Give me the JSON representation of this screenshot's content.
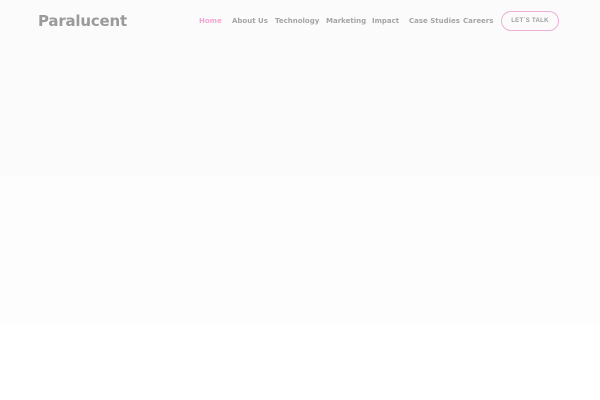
{
  "header": {
    "logo_text": "Paralucent",
    "cta_label": "LET`S TALK"
  },
  "nav": {
    "items": [
      {
        "label": "Home",
        "active": true
      },
      {
        "label": "About Us",
        "active": false
      },
      {
        "label": "Technology",
        "active": false
      },
      {
        "label": "Marketing",
        "active": false
      },
      {
        "label": "Impact",
        "active": false
      },
      {
        "label": "Case Studies",
        "active": false
      },
      {
        "label": "Careers",
        "active": false
      }
    ]
  },
  "colors": {
    "accent": "#f2a6d2",
    "text_muted": "#a5a5a5",
    "background": "#fcfcfc"
  }
}
